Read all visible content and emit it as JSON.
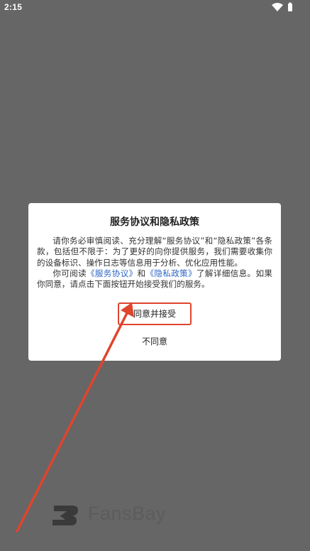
{
  "status_bar": {
    "time": "2:15",
    "icons": [
      "wifi-icon",
      "battery-icon"
    ]
  },
  "dialog": {
    "title": "服务协议和隐私政策",
    "paragraph1": "请你务必审慎阅读、充分理解“服务协议”和“隐私政策”各条款，包括但不限于：为了更好的向你提供服务，我们需要收集你的设备标识、操作日志等信息用于分析、优化应用性能。",
    "paragraph2_prefix": "你可阅读",
    "link_service": "《服务协议》",
    "paragraph2_and": "和",
    "link_privacy": "《隐私政策》",
    "paragraph2_suffix": "了解详细信息。如果你同意，请点击下面按钮开始接受我们的服务。",
    "accept_label": "同意并接受",
    "decline_label": "不同意"
  },
  "brand": {
    "name": "FansBay"
  },
  "colors": {
    "background": "#666666",
    "link": "#2d66c3",
    "annotation": "#e0442d"
  }
}
